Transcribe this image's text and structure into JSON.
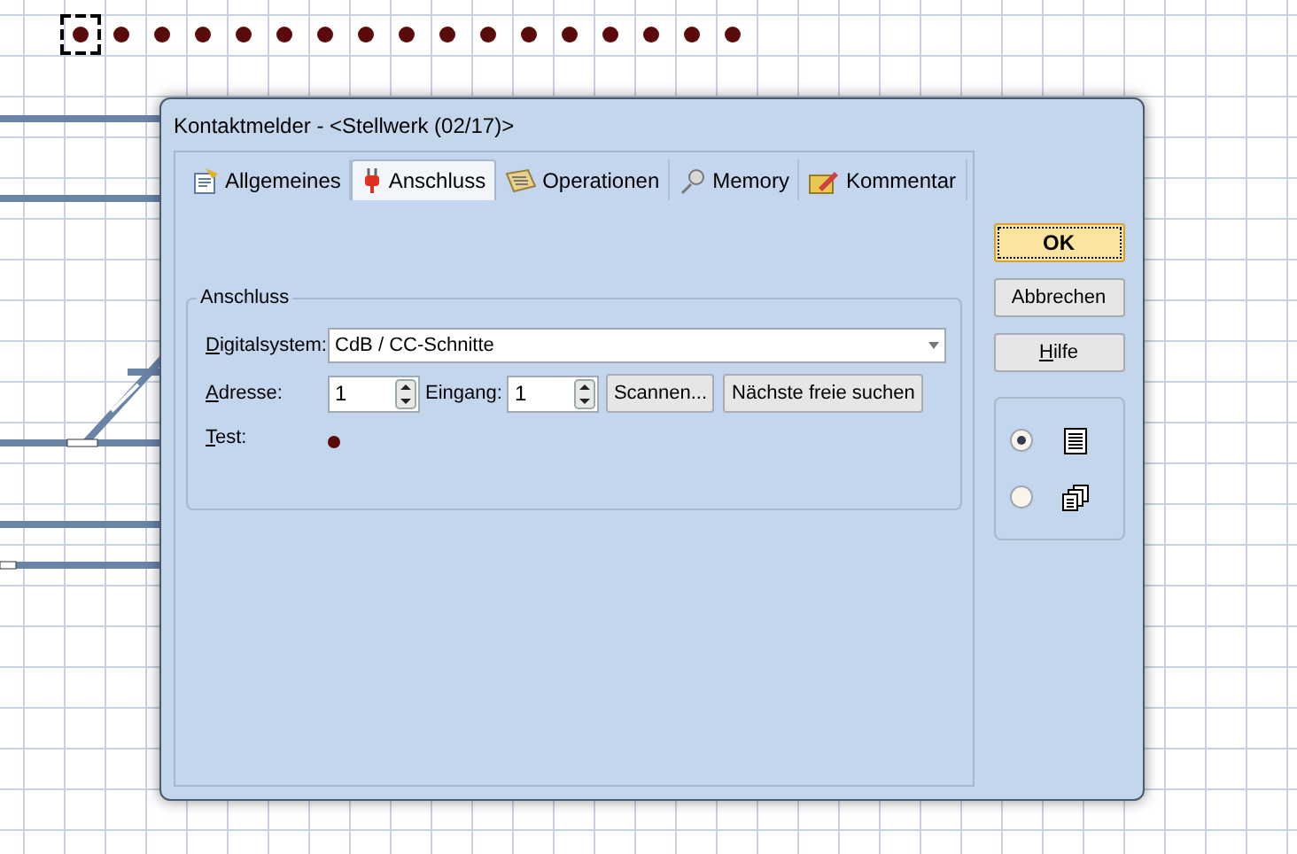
{
  "canvas": {
    "dots": [
      {
        "selected": true
      },
      {
        "selected": false
      },
      {
        "selected": false
      },
      {
        "selected": false
      },
      {
        "selected": false
      },
      {
        "selected": false
      },
      {
        "selected": false
      },
      {
        "selected": false
      },
      {
        "selected": false
      },
      {
        "selected": false
      },
      {
        "selected": false
      },
      {
        "selected": false
      },
      {
        "selected": false
      },
      {
        "selected": false
      },
      {
        "selected": false
      },
      {
        "selected": false
      },
      {
        "selected": false
      }
    ]
  },
  "window": {
    "title": "Kontaktmelder - <Stellwerk (02/17)>"
  },
  "tabs": [
    {
      "label": "Allgemeines",
      "kind": "general",
      "selected": false
    },
    {
      "label": "Anschluss",
      "kind": "plug",
      "selected": true
    },
    {
      "label": "Operationen",
      "kind": "keyboard",
      "selected": false
    },
    {
      "label": "Memory",
      "kind": "pin",
      "selected": false
    },
    {
      "label": "Kommentar",
      "kind": "note",
      "selected": false
    }
  ],
  "group": {
    "title": "Anschluss",
    "digital_system": {
      "label": "Digitalsystem:",
      "value": "CdB / CC-Schnitte"
    },
    "address": {
      "label": "Adresse:",
      "value": "1"
    },
    "input": {
      "label": "Eingang:",
      "value": "1"
    },
    "scan_button": "Scannen...",
    "next_free_button": "Nächste freie suchen",
    "test": {
      "label": "Test:",
      "on": false
    }
  },
  "buttons": [
    {
      "label": "OK",
      "default": true,
      "mnemonic": false
    },
    {
      "label": "Abbrechen",
      "default": false,
      "mnemonic": false
    },
    {
      "label": "Hilfe",
      "default": false,
      "mnemonic": true
    }
  ],
  "view_options": [
    {
      "kind": "list",
      "selected": true
    },
    {
      "kind": "windows",
      "selected": false
    }
  ]
}
